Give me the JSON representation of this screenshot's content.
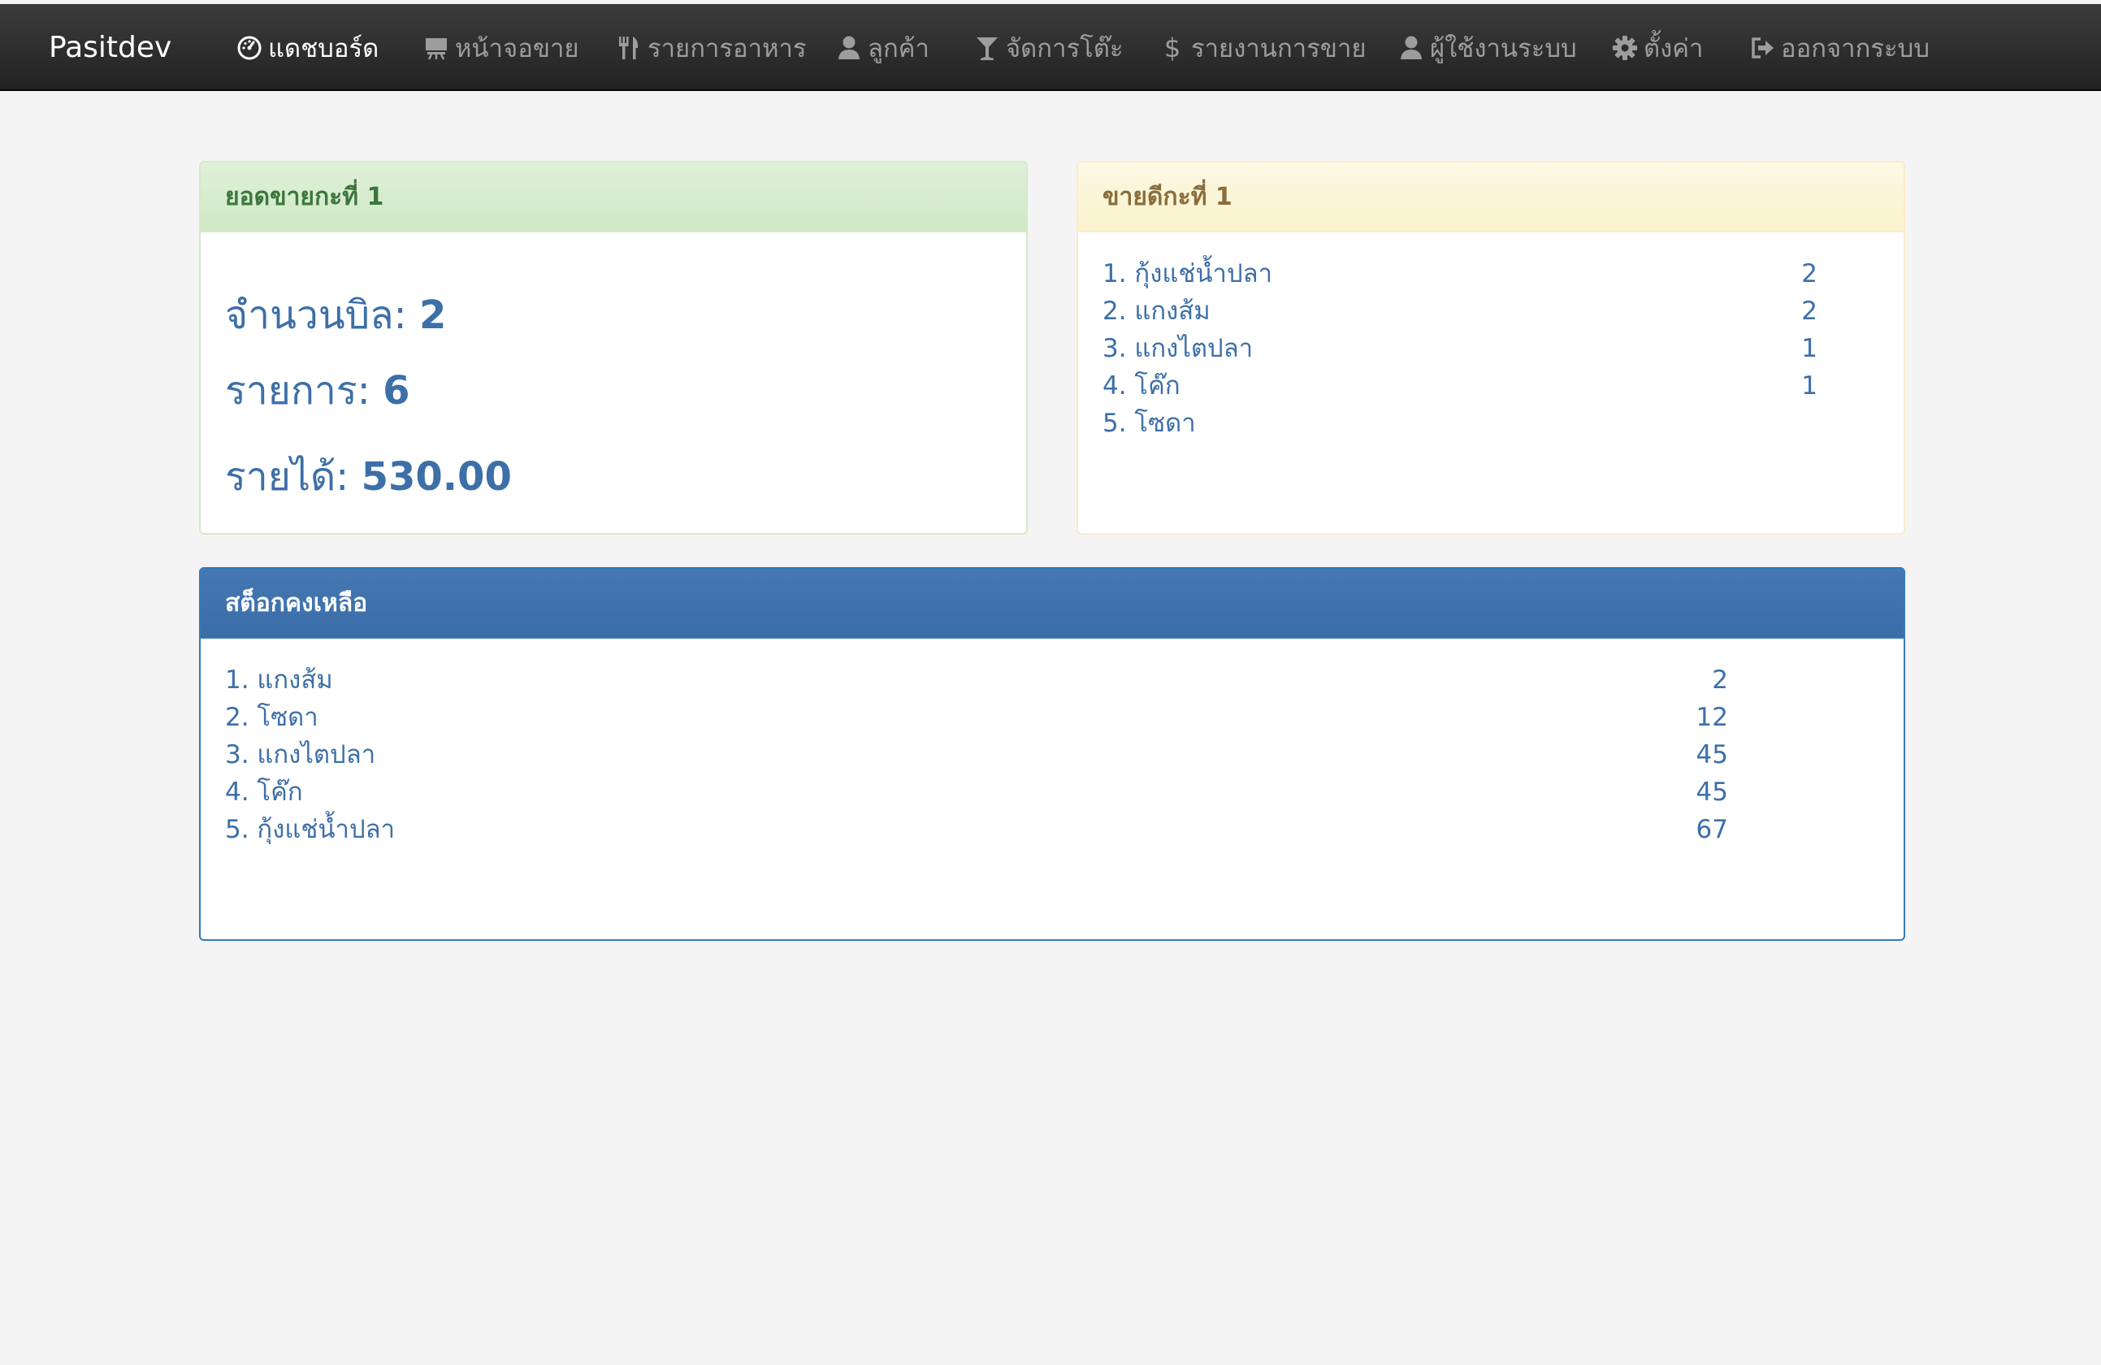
{
  "navbar": {
    "brand": "Pasitdev",
    "items": [
      {
        "label": "แดชบอร์ด",
        "icon": "dashboard-icon",
        "active": true
      },
      {
        "label": "หน้าจอขาย",
        "icon": "easel-icon"
      },
      {
        "label": "รายการอาหาร",
        "icon": "cutlery-icon"
      },
      {
        "label": "ลูกค้า",
        "icon": "user-icon"
      },
      {
        "label": "จัดการโต๊ะ",
        "icon": "glass-icon"
      },
      {
        "label": "รายงานการขาย",
        "icon": "dollar-icon"
      },
      {
        "label": "ผู้ใช้งานระบบ",
        "icon": "user-icon"
      },
      {
        "label": "ตั้งค่า",
        "icon": "gear-icon"
      },
      {
        "label": "ออกจากระบบ",
        "icon": "logout-icon"
      }
    ]
  },
  "sales_panel": {
    "title": "ยอดขายกะที่ 1",
    "bills_label": "จำนวนบิล:",
    "bills_value": "2",
    "items_label": "รายการ:",
    "items_value": "6",
    "income_label": "รายได้:",
    "income_value": "530.00"
  },
  "bestseller_panel": {
    "title": "ขายดีกะที่ 1",
    "rows": [
      {
        "name": "1. กุ้งแช่น้ำปลา",
        "qty": "2"
      },
      {
        "name": "2. แกงส้ม",
        "qty": "2"
      },
      {
        "name": "3. แกงไตปลา",
        "qty": "1"
      },
      {
        "name": "4. โค๊ก",
        "qty": "1"
      },
      {
        "name": "5. โซดา",
        "qty": ""
      }
    ]
  },
  "stock_panel": {
    "title": "สต็อกคงเหลือ",
    "rows": [
      {
        "name": "1. แกงส้ม",
        "qty": "2"
      },
      {
        "name": "2. โซดา",
        "qty": "12"
      },
      {
        "name": "3. แกงไตปลา",
        "qty": "45"
      },
      {
        "name": "4. โค๊ก",
        "qty": "45"
      },
      {
        "name": "5. กุ้งแช่น้ำปลา",
        "qty": "67"
      }
    ]
  },
  "colors": {
    "navbar": "#222222",
    "text_primary": "#3d6fa8",
    "success_heading": "#3c763d",
    "warning_heading": "#8a6d3b",
    "primary_heading_bg": "#4577b3"
  }
}
